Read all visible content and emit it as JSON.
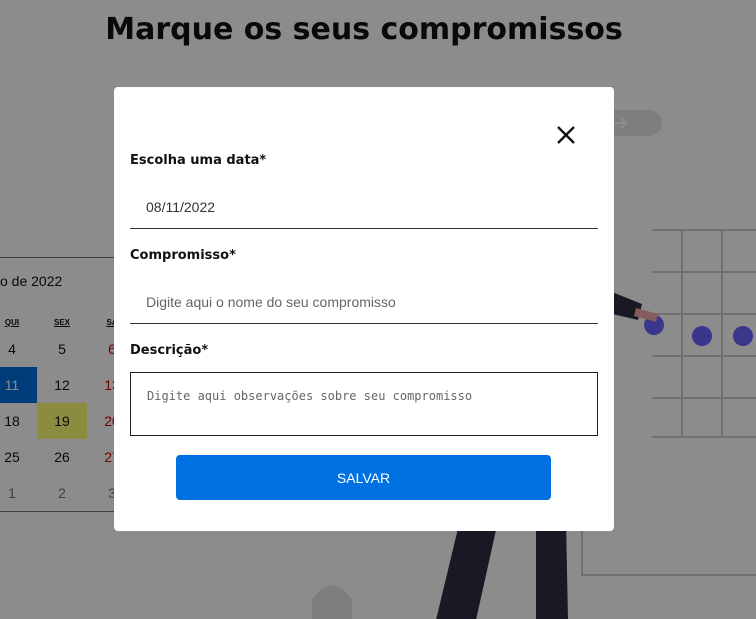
{
  "page": {
    "title": "Marque os seus compromissos"
  },
  "calendar": {
    "month_partial": "o de 2022",
    "weekdays": [
      "QUI",
      "SEX",
      "SÁ"
    ],
    "rows": [
      [
        "4",
        "5",
        "6"
      ],
      [
        "11",
        "12",
        "13"
      ],
      [
        "18",
        "19",
        "20"
      ],
      [
        "25",
        "26",
        "27"
      ],
      [
        "1",
        "2",
        "3"
      ]
    ],
    "selected_day": "11",
    "today": "19",
    "colors": {
      "selected": "#006edc",
      "today": "#ffff76",
      "weekend": "#d10000"
    }
  },
  "modal": {
    "close_icon": "close-icon",
    "date": {
      "label": "Escolha uma data*",
      "value": "08/11/2022"
    },
    "title": {
      "label": "Compromisso*",
      "placeholder": "Digite aqui o nome do seu compromisso"
    },
    "description": {
      "label": "Descrição*",
      "placeholder": "Digite aqui observações sobre seu compromisso"
    },
    "save_label": "SALVAR",
    "colors": {
      "save_button": "#0071e3",
      "overlay": "rgba(0,0,0,0.45)"
    }
  }
}
